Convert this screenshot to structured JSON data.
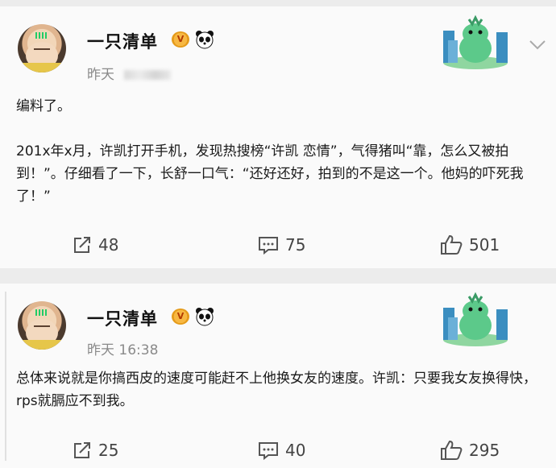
{
  "posts": [
    {
      "author": "一只清单",
      "time": "昨天",
      "content": "编料了。\n\n201x年x月，许凯打开手机，发现热搜榜“许凯 恋情”，气得猪叫“靠，怎么又被拍到！”。仔细看了一下，长舒一口气：“还好还好，拍到的不是这一个。他妈的吓死我了！”",
      "share_count": "48",
      "comment_count": "75",
      "like_count": "501"
    },
    {
      "author": "一只清单",
      "time": "昨天 16:38",
      "content": "总体来说就是你搞西皮的速度可能赶不上他换女友的速度。许凯：只要我女友换得快，rps就膈应不到我。",
      "share_count": "25",
      "comment_count": "40",
      "like_count": "295"
    }
  ],
  "icons": {
    "vip": "crown-icon",
    "emoji": "panda-icon",
    "sticker": "dinosaur-sticker",
    "more": "chevron-down-icon",
    "share": "share-icon",
    "comment": "comment-icon",
    "like": "thumbs-up-icon"
  },
  "colors": {
    "background": "#ececec",
    "card": "#fafafa",
    "meta_text": "#8a8a8a",
    "crown": "#f7b843"
  }
}
